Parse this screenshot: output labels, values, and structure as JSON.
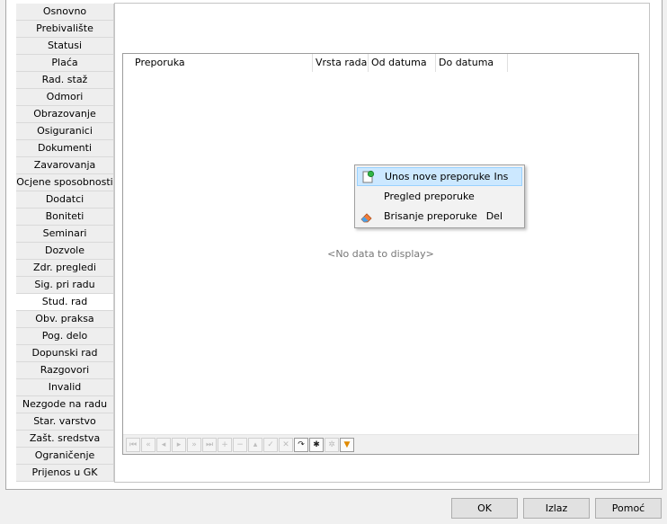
{
  "sidebar": {
    "tabs": [
      {
        "label": "Osnovno"
      },
      {
        "label": "Prebivalište"
      },
      {
        "label": "Statusi"
      },
      {
        "label": "Plaća"
      },
      {
        "label": "Rad. staž"
      },
      {
        "label": "Odmori"
      },
      {
        "label": "Obrazovanje"
      },
      {
        "label": "Osiguranici"
      },
      {
        "label": "Dokumenti"
      },
      {
        "label": "Zavarovanja"
      },
      {
        "label": "Ocjene sposobnosti"
      },
      {
        "label": "Dodatci"
      },
      {
        "label": "Boniteti"
      },
      {
        "label": "Seminari"
      },
      {
        "label": "Dozvole"
      },
      {
        "label": "Zdr. pregledi"
      },
      {
        "label": "Sig. pri radu"
      },
      {
        "label": "Stud. rad"
      },
      {
        "label": "Obv. praksa"
      },
      {
        "label": "Pog. delo"
      },
      {
        "label": "Dopunski rad"
      },
      {
        "label": "Razgovori"
      },
      {
        "label": "Invalid"
      },
      {
        "label": "Nezgode na radu"
      },
      {
        "label": "Star. varstvo"
      },
      {
        "label": "Zašt. sredstva"
      },
      {
        "label": "Ograničenje"
      },
      {
        "label": "Prijenos u GK"
      }
    ],
    "active_tab": "Stud. rad"
  },
  "grid": {
    "columns": [
      "Preporuka",
      "Vrsta rada",
      "Od datuma",
      "Do datuma"
    ],
    "empty_text": "<No data to display>",
    "navigator": [
      "first-icon",
      "prev-page-icon",
      "prev-icon",
      "next-icon",
      "next-page-icon",
      "last-icon",
      "insert-icon",
      "delete-icon",
      "edit-icon",
      "post-icon",
      "cancel-icon",
      "refresh-icon",
      "save-bookmark-icon",
      "goto-bookmark-icon",
      "filter-icon"
    ]
  },
  "context_menu": {
    "items": [
      {
        "label": "Unos nove preporuke",
        "shortcut": "Ins",
        "icon": "new-document-icon"
      },
      {
        "label": "Pregled preporuke",
        "shortcut": "",
        "icon": ""
      },
      {
        "label": "Brisanje preporuke",
        "shortcut": "Del",
        "icon": "eraser-icon"
      }
    ]
  },
  "buttons": {
    "ok": "OK",
    "exit": "Izlaz",
    "help": "Pomoć"
  },
  "colors": {
    "menu_highlight": "#cce8ff",
    "window_bg": "#f0f0f0",
    "active_tab_bg": "#ffffff"
  }
}
